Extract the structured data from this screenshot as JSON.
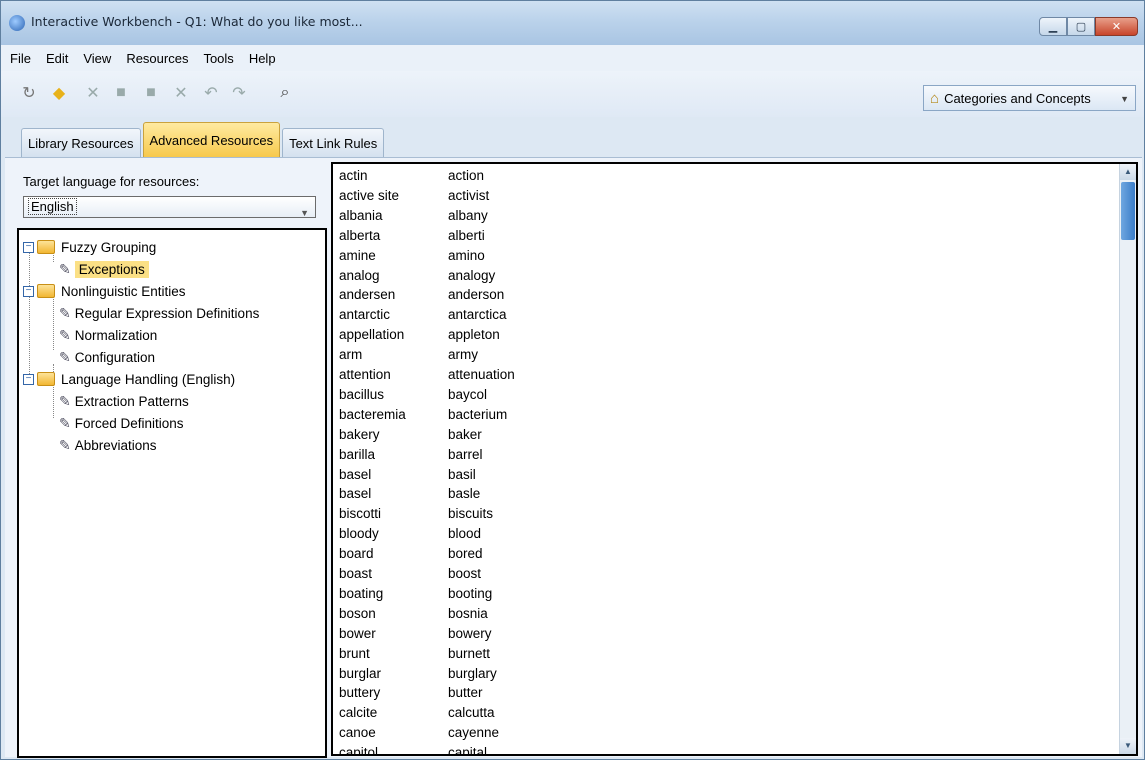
{
  "window": {
    "title": "Interactive Workbench - Q1: What do you like most..."
  },
  "menu": [
    {
      "label": "File"
    },
    {
      "label": "Edit"
    },
    {
      "label": "View"
    },
    {
      "label": "Resources"
    },
    {
      "label": "Tools"
    },
    {
      "label": "Help"
    }
  ],
  "toolbar": {
    "view_selector": "Categories and Concepts",
    "icons": [
      "new-icon",
      "diamond-icon",
      "cut-icon",
      "copy-icon",
      "paste-icon",
      "delete-icon",
      "undo-icon",
      "redo-icon",
      "find-icon"
    ]
  },
  "tabs": [
    {
      "label": "Library Resources",
      "active": false
    },
    {
      "label": "Advanced Resources",
      "active": true
    },
    {
      "label": "Text Link Rules",
      "active": false
    }
  ],
  "left": {
    "lang_label": "Target language for resources:",
    "lang_value": "English"
  },
  "tree": [
    {
      "label": "Fuzzy Grouping",
      "type": "folder",
      "level": 0
    },
    {
      "label": "Exceptions",
      "type": "item",
      "level": 1,
      "selected": true
    },
    {
      "label": "Nonlinguistic Entities",
      "type": "folder",
      "level": 0
    },
    {
      "label": "Regular Expression Definitions",
      "type": "item",
      "level": 1
    },
    {
      "label": "Normalization",
      "type": "item",
      "level": 1
    },
    {
      "label": "Configuration",
      "type": "item",
      "level": 1
    },
    {
      "label": "Language Handling (English)",
      "type": "folder",
      "level": 0
    },
    {
      "label": "Extraction Patterns",
      "type": "item",
      "level": 1
    },
    {
      "label": "Forced Definitions",
      "type": "item",
      "level": 1
    },
    {
      "label": "Abbreviations",
      "type": "item",
      "level": 1
    }
  ],
  "exceptions": [
    [
      "actin",
      "action"
    ],
    [
      "active site",
      "activist"
    ],
    [
      "albania",
      "albany"
    ],
    [
      "alberta",
      "alberti"
    ],
    [
      "amine",
      "amino"
    ],
    [
      "analog",
      "analogy"
    ],
    [
      "andersen",
      "anderson"
    ],
    [
      "antarctic",
      "antarctica"
    ],
    [
      "appellation",
      "appleton"
    ],
    [
      "arm",
      "army"
    ],
    [
      "attention",
      "attenuation"
    ],
    [
      "bacillus",
      "baycol"
    ],
    [
      "bacteremia",
      "bacterium"
    ],
    [
      "bakery",
      "baker"
    ],
    [
      "barilla",
      "barrel"
    ],
    [
      "basel",
      "basil"
    ],
    [
      "basel",
      "basle"
    ],
    [
      "biscotti",
      "biscuits"
    ],
    [
      "bloody",
      "blood"
    ],
    [
      "board",
      "bored"
    ],
    [
      "boast",
      "boost"
    ],
    [
      "boating",
      "booting"
    ],
    [
      "boson",
      "bosnia"
    ],
    [
      "bower",
      "bowery"
    ],
    [
      "brunt",
      "burnett"
    ],
    [
      "burglar",
      "burglary"
    ],
    [
      "buttery",
      "butter"
    ],
    [
      "calcite",
      "calcutta"
    ],
    [
      "canoe",
      "cayenne"
    ],
    [
      "capitol",
      "capital"
    ]
  ]
}
